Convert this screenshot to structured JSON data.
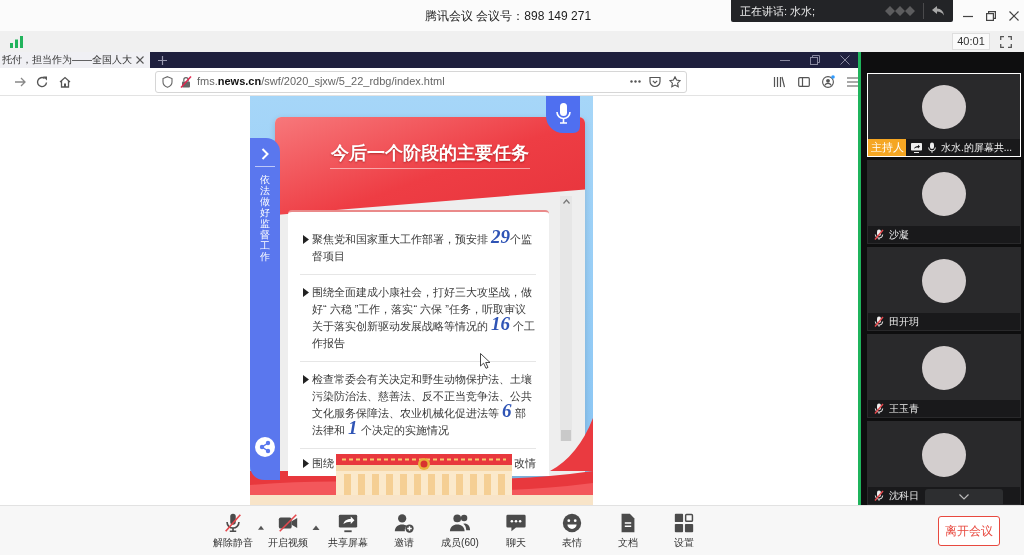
{
  "title_bar": {
    "title": "腾讯会议 会议号：898 149 271"
  },
  "speaker_popup": {
    "text": "正在讲话: 水水;"
  },
  "info_bar": {
    "timer": "40:01"
  },
  "browser": {
    "tab": {
      "title": "托付，担当作为——全国人大"
    },
    "address": "fms.**news.cn**/swf/2020_sjxw/5_22_rdbg/index.html"
  },
  "web_page": {
    "side_tab": {
      "label": "依法做好监督工作"
    },
    "heading": "今后一个阶段的主要任务",
    "tasks": [
      {
        "kind": "full",
        "parts": [
          {
            "kind": "text",
            "text": "聚焦党和国家重大工作部署，预安排 "
          },
          {
            "kind": "number",
            "text": "29"
          },
          {
            "kind": "text",
            "text": "个监督项目"
          }
        ]
      },
      {
        "kind": "full",
        "parts": [
          {
            "kind": "text",
            "text": "围绕全面建成小康社会，打好三大攻坚战，做好“ 六稳 ”工作，落实“ 六保 ”任务，听取审议关于落实创新驱动发展战略等情况的 "
          },
          {
            "kind": "number",
            "text": "16"
          },
          {
            "kind": "text",
            "text": " 个工作报告"
          }
        ]
      },
      {
        "kind": "full",
        "parts": [
          {
            "kind": "text",
            "text": "检查常委会有关决定和野生动物保护法、土壤污染防治法、慈善法、反不正当竞争法、公共文化服务保障法、农业机械化促进法等 "
          },
          {
            "kind": "number",
            "text": "6"
          },
          {
            "kind": "text",
            "text": " 部法律和 "
          },
          {
            "kind": "number",
            "text": "1"
          },
          {
            "kind": "text",
            "text": " 个决定的实施情况"
          }
        ]
      },
      {
        "kind": "obscured",
        "fragments": [
          "围绕",
          "改情"
        ]
      }
    ]
  },
  "participants": [
    {
      "name": "水水.的屏幕共...",
      "role": "主持人",
      "speaking": true,
      "sharing": true,
      "muted": false
    },
    {
      "name": "沙凝",
      "speaking": false,
      "sharing": false,
      "muted": true
    },
    {
      "name": "田开玥",
      "speaking": false,
      "sharing": false,
      "muted": true
    },
    {
      "name": "王玉青",
      "speaking": false,
      "sharing": false,
      "muted": true
    },
    {
      "name": "沈科日",
      "speaking": false,
      "sharing": false,
      "muted": true
    }
  ],
  "toolbar": {
    "buttons": [
      {
        "kind": "microphone",
        "label": "解除静音",
        "muted": true,
        "has_menu": true
      },
      {
        "kind": "camera",
        "label": "开启视频",
        "off": true,
        "has_menu": true
      },
      {
        "kind": "share",
        "label": "共享屏幕"
      },
      {
        "kind": "invite",
        "label": "邀请"
      },
      {
        "kind": "members",
        "label": "成员(60)"
      },
      {
        "kind": "chat",
        "label": "聊天"
      },
      {
        "kind": "emoji",
        "label": "表情"
      },
      {
        "kind": "docs",
        "label": "文档"
      },
      {
        "kind": "settings",
        "label": "设置"
      }
    ],
    "leave_button": "离开会议"
  }
}
